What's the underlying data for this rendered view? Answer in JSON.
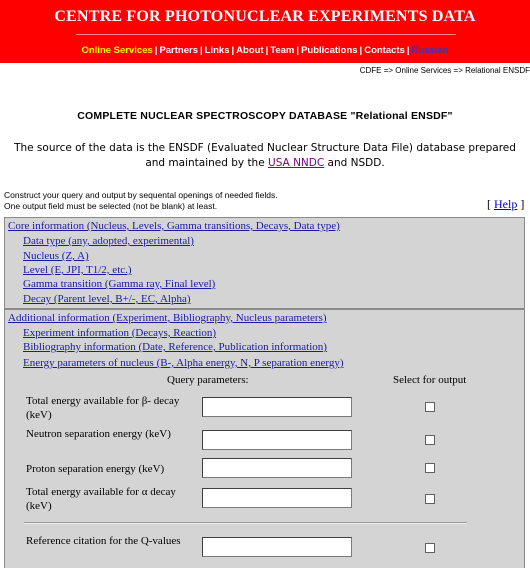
{
  "site": {
    "title": "CENTRE FOR PHOTONUCLEAR EXPERIMENTS DATA"
  },
  "nav": {
    "items": [
      "Online Services",
      "Partners",
      "Links",
      "About",
      "Team",
      "Publications",
      "Contacts",
      "Russian"
    ],
    "separator": "|"
  },
  "breadcrumb": "CDFE => Online Services => Relational ENSDF",
  "page": {
    "title": "COMPLETE NUCLEAR SPECTROSCOPY DATABASE \"Relational ENSDF\"",
    "source_pre": "The source of the data is the ENSDF (Evaluated Nuclear Structure Data File) database prepared and maintained by the ",
    "source_link": "USA NNDC",
    "source_post": " and NSDD."
  },
  "instructions": {
    "line1": "Construct your query and output by sequental openings of needed fields.",
    "line2": "One output field must be selected (not be blank) at least."
  },
  "help": {
    "open": "[",
    "label": "Help",
    "close": "]"
  },
  "core": {
    "header": "Core information (Nucleus, Levels, Gamma transitions, Decays, Data type)",
    "items": [
      "Data type (any, adopted, experimental)",
      "Nucleus (Z, A)",
      "Level (E, JPI, T1/2, etc.)",
      "Gamma transition (Gamma ray, Final level)",
      "Decay (Parent level, B+/-, EC, Alpha)"
    ]
  },
  "additional": {
    "header": "Additional information (Experiment, Bibliography, Nucleus parameters)",
    "items": [
      "Experiment information (Decays, Reaction)",
      "Bibliography information (Date, Reference, Publication information)",
      "Energy parameters of nucleus (B-, Alpha energy, N, P separation energy)"
    ]
  },
  "query": {
    "params_header": "Query parameters:",
    "output_header": "Select for output",
    "fields": [
      {
        "label": "Total energy available for β- decay (keV)",
        "value": "",
        "checked": false
      },
      {
        "label": "Neutron separation energy (keV)",
        "value": "",
        "checked": false
      },
      {
        "label": "Proton separation energy (keV)",
        "value": "",
        "checked": false
      },
      {
        "label": "Total energy available for α decay (keV)",
        "value": "",
        "checked": false
      },
      {
        "label": "Reference citation for the Q-values",
        "value": "",
        "checked": false
      }
    ]
  }
}
